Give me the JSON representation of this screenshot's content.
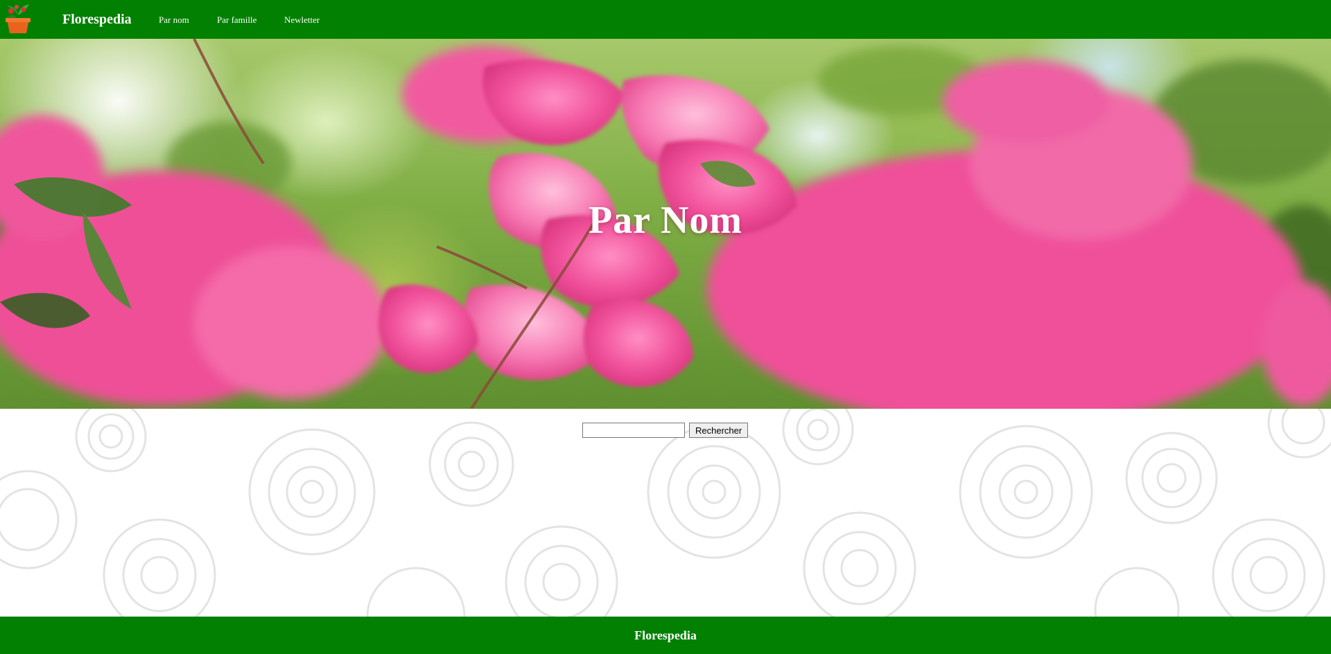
{
  "header": {
    "brand": "Florespedia",
    "nav": [
      {
        "label": "Par nom"
      },
      {
        "label": "Par famille"
      },
      {
        "label": "Newletter"
      }
    ]
  },
  "hero": {
    "title": "Par Nom"
  },
  "search": {
    "value": "",
    "button_label": "Rechercher"
  },
  "footer": {
    "text": "Florespedia"
  },
  "colors": {
    "header_bg": "#018001",
    "footer_bg": "#018001",
    "flower_pink": "#f0529a",
    "text_light": "#ffffff"
  },
  "icons": {
    "logo": "potted-plant-icon"
  }
}
